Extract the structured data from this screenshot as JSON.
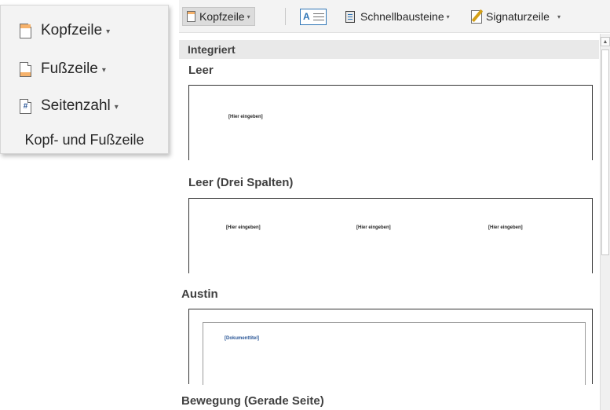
{
  "ribbon_group": {
    "items": [
      {
        "label": "Kopfzeile",
        "icon": "header-doc-icon"
      },
      {
        "label": "Fußzeile",
        "icon": "footer-doc-icon"
      },
      {
        "label": "Seitenzahl",
        "icon": "page-number-icon"
      }
    ],
    "page_number_glyph": "#",
    "dropdown_glyph": "▾",
    "caption": "Kopf- und Fußzeile"
  },
  "toolbar": {
    "header_label": "Kopfzeile",
    "textbox_glyph": "A",
    "quickparts_label": "Schnellbausteine",
    "signature_label": "Signaturzeile",
    "dropdown_glyph": "▾"
  },
  "gallery": {
    "category": "Integriert",
    "items": [
      {
        "title": "Leer",
        "placeholders": [
          "[Hier eingeben]"
        ]
      },
      {
        "title": "Leer (Drei Spalten)",
        "placeholders": [
          "[Hier eingeben]",
          "[Hier eingeben]",
          "[Hier eingeben]"
        ]
      },
      {
        "title": "Austin",
        "placeholders": [
          "[Dokumenttitel]"
        ]
      },
      {
        "title": "Bewegung (Gerade Seite)",
        "placeholders": []
      }
    ]
  },
  "scrollbar": {
    "up_glyph": "▲"
  },
  "colors": {
    "accent_orange": "#f6b26b",
    "accent_blue": "#2b5797",
    "ribbon_bg": "#f3f3f3",
    "category_bg": "#e9e9e9"
  }
}
